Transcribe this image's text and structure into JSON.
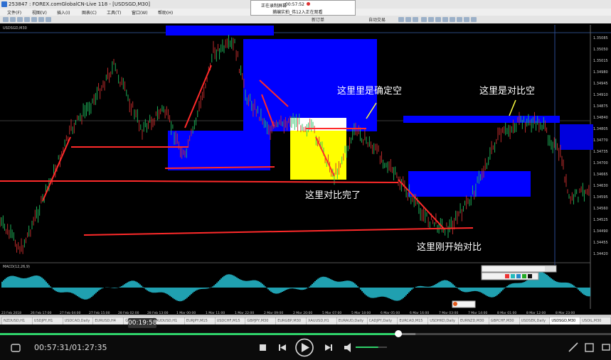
{
  "window": {
    "title": "253847 : FOREX.comGlobalCN-Live 118 - [USDSGD,M30]"
  },
  "recorder": {
    "line1": "正在录制屏幕",
    "time": "00:57:52",
    "line2": "捕编实拍_伟12入正在观看"
  },
  "menu": {
    "items": [
      "文件(F)",
      "视图(V)",
      "插入(I)",
      "图表(C)",
      "工具(T)",
      "窗口(W)",
      "帮助(H)"
    ]
  },
  "toolbar": {
    "new_order": "新订单",
    "auto_trade": "自动交易"
  },
  "chart": {
    "symbol_header": "USDSGD,M30",
    "indicator_label": "MACD(12,26,9)",
    "annotations": {
      "confirm_short": "这里里是确定空",
      "compare_short": "这里是对比空",
      "compare_done": "这里对比完了",
      "compare_start": "这里刚开始对比"
    },
    "price_labels": [
      "1.35085",
      "1.35050",
      "1.35015",
      "1.34980",
      "1.34945",
      "1.34910",
      "1.34875",
      "1.34840",
      "1.34805",
      "1.34770",
      "1.34735",
      "1.34700",
      "1.34665",
      "1.34630",
      "1.34595",
      "1.34560",
      "1.34525",
      "1.34490",
      "1.34455",
      "1.34420"
    ],
    "time_labels": [
      "23 Feb 2018",
      "26 Feb 17:00",
      "27 Feb 04:00",
      "27 Feb 15:00",
      "28 Feb 02:00",
      "28 Feb 13:00",
      "1 Mar 00:00",
      "1 Mar 11:00",
      "1 Mar 22:00",
      "2 Mar 09:00",
      "2 Mar 20:00",
      "5 Mar 07:00",
      "5 Mar 18:00",
      "6 Mar 05:00",
      "6 Mar 16:00",
      "7 Mar 03:00",
      "7 Mar 14:00",
      "8 Mar 01:00",
      "8 Mar 12:00",
      "8 Mar 23:00"
    ],
    "colors": {
      "zone": "#0000ff",
      "highlight": "#ffff00",
      "arrow": "#ff2222",
      "histogram": "#20a0b0",
      "bull": "#20c060",
      "bear": "#d03030"
    }
  },
  "symbol_tabs": {
    "items": [
      "NZDUSD,H1",
      "USDJPY,H1",
      "USDCAD,Daily",
      "EURUSD,H4",
      "GBPUSD,H1",
      "AUDUSD,H1",
      "EURJPY,M15",
      "USDCHF,M15",
      "GBPJPY,M30",
      "EURGBP,M30",
      "XAUUSD,H1",
      "EURAUD,Daily",
      "CADJPY,Daily",
      "EURCAD,M15",
      "USDHKD,Daily",
      "EURNZD,M30",
      "GBPCHF,M30",
      "USDSEK,Daily",
      "USDSGD,M30",
      "USOIL,M30"
    ],
    "active_index": 18
  },
  "player": {
    "tooltip_time": "00:19:58",
    "current_time": "00:57:31",
    "total_time": "01:27:35",
    "separator": "/",
    "progress": 0.652,
    "buffered": 0.68,
    "volume": 0.72
  }
}
